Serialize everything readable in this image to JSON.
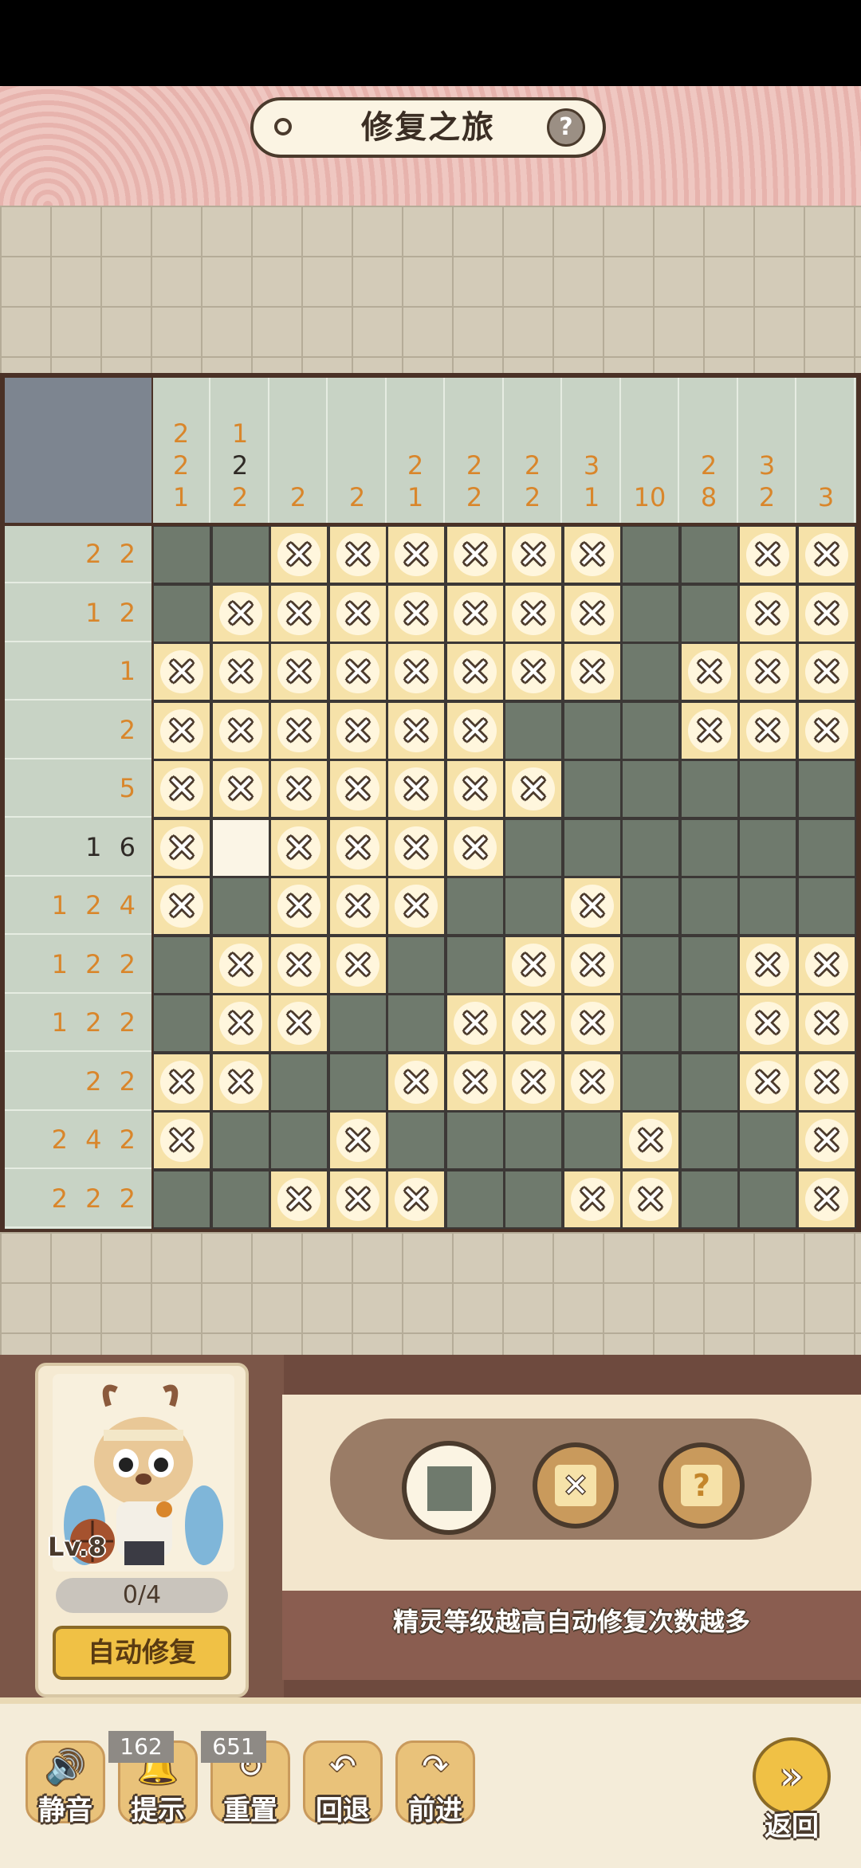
{
  "header": {
    "title": "修复之旅",
    "help_icon": "?"
  },
  "puzzle": {
    "col_clues": [
      {
        "nums": [
          "2",
          "2",
          "1"
        ],
        "done": false
      },
      {
        "nums": [
          "1",
          "2",
          "2"
        ],
        "done_index": 1
      },
      {
        "nums": [
          "2"
        ]
      },
      {
        "nums": [
          "2"
        ]
      },
      {
        "nums": [
          "2",
          "1"
        ]
      },
      {
        "nums": [
          "2",
          "2"
        ]
      },
      {
        "nums": [
          "2",
          "2"
        ]
      },
      {
        "nums": [
          "3",
          "1"
        ]
      },
      {
        "nums": [
          "10"
        ]
      },
      {
        "nums": [
          "2",
          "8"
        ]
      },
      {
        "nums": [
          "3",
          "2"
        ]
      },
      {
        "nums": [
          "3"
        ]
      }
    ],
    "row_clues": [
      {
        "text": "2 2"
      },
      {
        "text": "1 2"
      },
      {
        "text": "1"
      },
      {
        "text": "2"
      },
      {
        "text": "5"
      },
      {
        "text": "1 6",
        "done": true
      },
      {
        "text": "1 2 4"
      },
      {
        "text": "1 2 2"
      },
      {
        "text": "1 2 2"
      },
      {
        "text": "2 2"
      },
      {
        "text": "2 4 2"
      },
      {
        "text": "2 2 2"
      }
    ],
    "grid": [
      "FFXXXXXXFFXX",
      "FXXXXXXXFFXX",
      "XXXXXXXXFXXX",
      "XXXXXXFFFXXX",
      "XXXXXXXFFFFF",
      "XEXXXXFFFFFF",
      "XFXXXFFXFFFF",
      "FXXXFFXXFFXX",
      "FXXFFXXXFFXX",
      "XXFFXXXXFFXX",
      "XFFXFFFFXFFX",
      "FFXXXFFXXFFX"
    ]
  },
  "sprite": {
    "level": "Lv.8",
    "progress": "0/4",
    "auto_repair_label": "自动修复"
  },
  "tools": {
    "fill_icon": "square-fill-icon",
    "cross_icon": "cross-icon",
    "unknown_icon": "?"
  },
  "tip": "精灵等级越高自动修复次数越多",
  "toolbar": {
    "mute": {
      "label": "静音",
      "icon": "🔊"
    },
    "hint": {
      "label": "提示",
      "icon": "🔔",
      "count": "162"
    },
    "reset": {
      "label": "重置",
      "icon": "↻",
      "count": "651"
    },
    "undo": {
      "label": "回退",
      "icon": "↶"
    },
    "redo": {
      "label": "前进",
      "icon": "↷"
    },
    "back": {
      "label": "返回",
      "icon": "»"
    }
  },
  "colors": {
    "filled": "#6f7a6d",
    "crossed": "#f6e2a9",
    "clue": "#d9862b",
    "clue_done": "#2f2a26"
  }
}
